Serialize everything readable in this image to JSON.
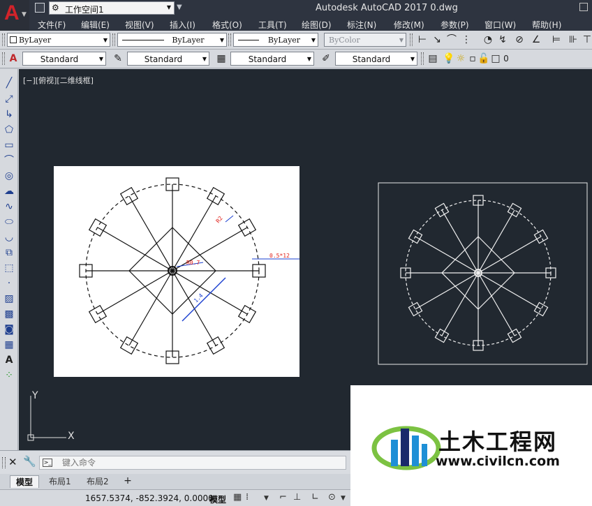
{
  "titlebar": {
    "workspace": "工作空间1",
    "title": "Autodesk AutoCAD 2017    0.dwg",
    "app_logo": "A"
  },
  "menus": [
    "文件(F)",
    "编辑(E)",
    "视图(V)",
    "插入(I)",
    "格式(O)",
    "工具(T)",
    "绘图(D)",
    "标注(N)",
    "修改(M)",
    "参数(P)",
    "窗口(W)",
    "帮助(H)"
  ],
  "properties": {
    "color": "ByLayer",
    "linetype": "ByLayer",
    "lineweight": "ByLayer",
    "plotstyle": "ByColor"
  },
  "styles": {
    "text_style": "Standard",
    "dim_style": "Standard",
    "table_style": "Standard",
    "multileader_style": "Standard",
    "layer": "0"
  },
  "viewport": {
    "label": "[−][俯视][二维线框]"
  },
  "annotations": {
    "dim_top": "R2",
    "dim_right": "0.5*12",
    "dim_center": "R0.7",
    "dim_diag": "1.4"
  },
  "ucs": {
    "y": "Y",
    "x": "X"
  },
  "command": {
    "placeholder": "键入命令"
  },
  "tabs": {
    "model": "模型",
    "layout1": "布局1",
    "layout2": "布局2",
    "add": "+"
  },
  "status": {
    "coords": "1657.5374, -852.3924, 0.0000",
    "model": "模型"
  },
  "watermark": {
    "title": "土木工程网",
    "url": "www.civilcn.com"
  },
  "colors": {
    "canvas": "#212830",
    "titlebar": "#2e3440",
    "toolbar": "#d6d9de",
    "logo_red": "#d2232a",
    "dim_red": "#e0201a",
    "dim_blue": "#1a3fd0",
    "wm_blue": "#1e8fd6",
    "wm_green": "#7cc242",
    "wm_dark": "#1a2a6b"
  }
}
